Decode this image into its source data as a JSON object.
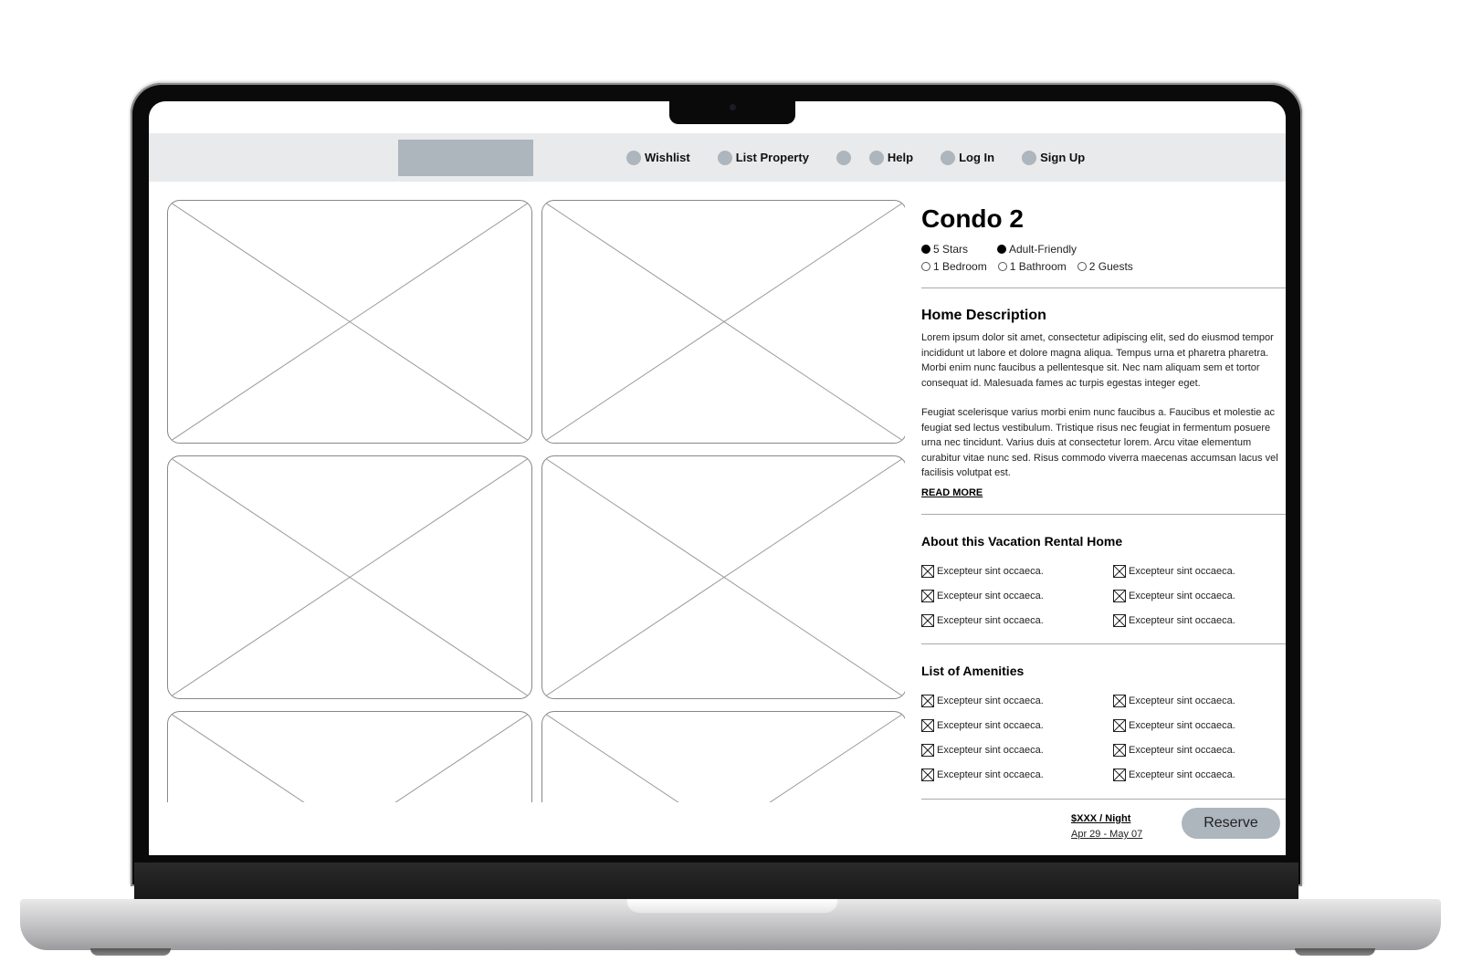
{
  "nav": {
    "logo_label": "",
    "items": [
      {
        "label": "Wishlist",
        "icon": "circle-icon"
      },
      {
        "label": "List Property",
        "icon": "circle-icon"
      },
      {
        "label": "",
        "icon": "circle-icon"
      },
      {
        "label": "Help",
        "icon": "circle-icon"
      },
      {
        "label": "Log In",
        "icon": "circle-icon"
      },
      {
        "label": "Sign Up",
        "icon": "circle-icon"
      }
    ]
  },
  "gallery": {
    "photo_count": 6,
    "placeholder_icon": "image-placeholder-icon"
  },
  "listing": {
    "title": "Condo 2",
    "tags": [
      {
        "label": "5 Stars",
        "filled": true
      },
      {
        "label": "Adult-Friendly",
        "filled": true
      },
      {
        "label": "1 Bedroom",
        "filled": false
      },
      {
        "label": "1 Bathroom",
        "filled": false
      },
      {
        "label": "2 Guests",
        "filled": false
      }
    ]
  },
  "description": {
    "heading": "Home Description",
    "paragraphs": [
      "Lorem ipsum dolor sit amet, consectetur adipiscing elit, sed do eiusmod tempor incididunt ut labore et dolore magna aliqua. Tempus urna et pharetra pharetra. Morbi enim nunc faucibus a pellentesque sit. Nec nam aliquam sem et tortor consequat id. Malesuada fames ac turpis egestas integer eget.",
      "Feugiat scelerisque varius morbi enim nunc faucibus a. Faucibus et molestie ac feugiat sed lectus vestibulum. Tristique risus nec feugiat in fermentum posuere urna nec tincidunt. Varius duis at consectetur lorem. Arcu vitae elementum curabitur vitae nunc sed. Risus commodo viverra maecenas accumsan lacus vel facilisis volutpat est."
    ],
    "read_more": "READ MORE"
  },
  "about": {
    "heading": "About this Vacation Rental Home",
    "items": [
      "Excepteur sint occaeca.",
      "Excepteur sint occaeca.",
      "Excepteur sint occaeca.",
      "Excepteur sint occaeca.",
      "Excepteur sint occaeca.",
      "Excepteur sint occaeca."
    ]
  },
  "amenities": {
    "heading": "List of Amenities",
    "items": [
      "Excepteur sint occaeca.",
      "Excepteur sint occaeca.",
      "Excepteur sint occaeca.",
      "Excepteur sint occaeca.",
      "Excepteur sint occaeca.",
      "Excepteur sint occaeca.",
      "Excepteur sint occaeca.",
      "Excepteur sint occaeca."
    ]
  },
  "booking": {
    "price": "$XXX / Night",
    "dates": "Apr 29 - May 07",
    "reserve_label": "Reserve"
  },
  "colors": {
    "nav_bg": "#e8eaec",
    "placeholder_gray": "#adb5bd",
    "text": "#000000"
  }
}
